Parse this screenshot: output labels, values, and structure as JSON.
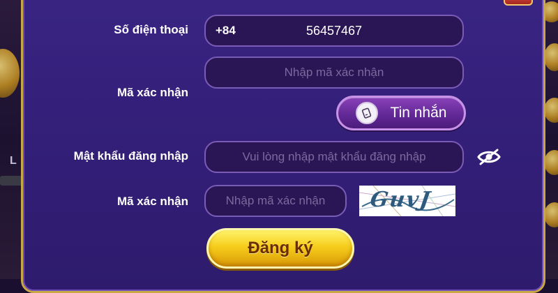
{
  "form": {
    "phone_label": "Số điện thoại",
    "phone_prefix": "+84",
    "phone_value": "56457467",
    "otp_label": "Mã xác nhận",
    "otp_placeholder": "Nhập mã xác nhận",
    "sms_button_label": "Tin nhắn",
    "password_label": "Mật khẩu đăng nhập",
    "password_placeholder": "Vui lòng nhập mật khẩu đăng nhập",
    "captcha_label": "Mã xác nhận",
    "captcha_placeholder": "Nhập mã xác nhận",
    "captcha_text": "GuvJ",
    "register_button_label": "Đăng ký"
  },
  "background": {
    "left_partial_text": "L"
  },
  "colors": {
    "panel": "#34207a",
    "panel_border": "#c9a646",
    "field_bg": "#2b1655",
    "field_border": "#7a5cb6",
    "register_button": "#f6cd1c",
    "sms_button": "#5f2793"
  },
  "icons": {
    "sms": "phone-icon",
    "password_visibility": "eye-slash-icon",
    "close": "close-icon"
  }
}
